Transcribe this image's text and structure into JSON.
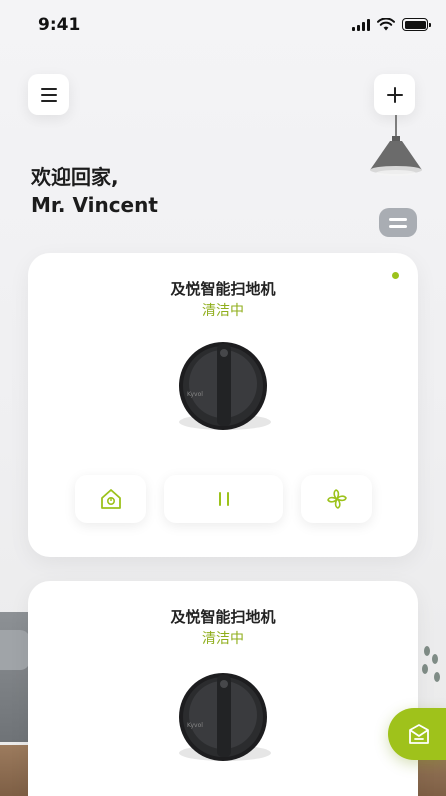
{
  "status_bar": {
    "time": "9:41"
  },
  "greeting": {
    "line1": "欢迎回家,",
    "line2": "Mr. Vincent"
  },
  "cards": [
    {
      "title": "及悦智能扫地机",
      "status": "清洁中"
    },
    {
      "title": "及悦智能扫地机",
      "status": "清洁中"
    }
  ],
  "robot": {
    "brand_text": "Kyvol"
  },
  "icons": {
    "menu": "menu-icon",
    "add": "plus-icon",
    "home": "home-icon",
    "pause": "pause-icon",
    "fan": "fan-icon",
    "fab": "inbox-icon"
  },
  "colors": {
    "accent": "#9cc21b",
    "status_text": "#8fae1b",
    "card_bg": "#ffffff",
    "toggle_bg": "#a9adb3"
  }
}
